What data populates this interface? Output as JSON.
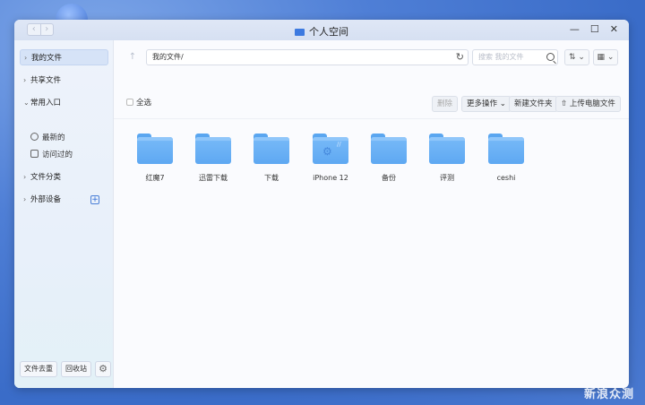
{
  "window": {
    "title": "个人空间",
    "nav_back": "‹",
    "nav_forward": "›",
    "minimize": "—",
    "maximize": "☐",
    "close": "✕"
  },
  "sidebar": {
    "my_files": "我的文件",
    "shared_files": "共享文件",
    "common_entry": "常用入口",
    "recent": "最新的",
    "visited": "访问过的",
    "file_category": "文件分类",
    "external_device": "外部设备",
    "add": "+",
    "dedupe": "文件去重",
    "recycle": "回收站",
    "settings": "⚙"
  },
  "toolbar": {
    "up": "↑",
    "path": "我的文件/",
    "refresh": "↻",
    "search_placeholder": "搜索 我的文件",
    "sort_icon": "⇅ ⌄",
    "view_icon": "▦ ⌄",
    "select_all": "全选",
    "delete": "删除",
    "more_ops": "更多操作 ⌄",
    "new_folder": "新建文件夹",
    "upload": "⇧ 上传电脑文件"
  },
  "files": [
    {
      "name": "红魔7"
    },
    {
      "name": "迅雷下载"
    },
    {
      "name": "下载"
    },
    {
      "name": "iPhone 12"
    },
    {
      "name": "备份"
    },
    {
      "name": "评测"
    },
    {
      "name": "ceshi"
    }
  ],
  "watermark": "新浪众测"
}
